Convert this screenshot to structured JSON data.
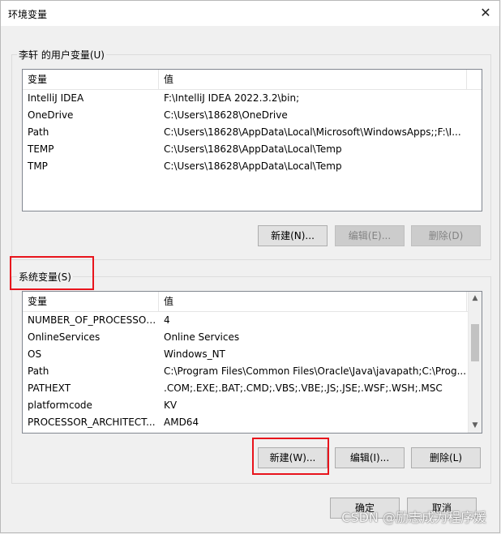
{
  "window": {
    "title": "环境变量",
    "close_glyph": "✕"
  },
  "user_vars": {
    "group_label": "李轩 的用户变量(U)",
    "columns": [
      "变量",
      "值"
    ],
    "rows": [
      [
        "IntelliJ IDEA",
        "F:\\IntelliJ IDEA 2022.3.2\\bin;"
      ],
      [
        "OneDrive",
        "C:\\Users\\18628\\OneDrive"
      ],
      [
        "Path",
        "C:\\Users\\18628\\AppData\\Local\\Microsoft\\WindowsApps;;F:\\I..."
      ],
      [
        "TEMP",
        "C:\\Users\\18628\\AppData\\Local\\Temp"
      ],
      [
        "TMP",
        "C:\\Users\\18628\\AppData\\Local\\Temp"
      ]
    ],
    "buttons": {
      "new": "新建(N)...",
      "edit": "编辑(E)...",
      "delete": "删除(D)"
    }
  },
  "system_vars": {
    "group_label": "系统变量(S)",
    "columns": [
      "变量",
      "值"
    ],
    "rows": [
      [
        "NUMBER_OF_PROCESSORS",
        "4"
      ],
      [
        "OnlineServices",
        "Online Services"
      ],
      [
        "OS",
        "Windows_NT"
      ],
      [
        "Path",
        "C:\\Program Files\\Common Files\\Oracle\\Java\\javapath;C:\\Prog..."
      ],
      [
        "PATHEXT",
        ".COM;.EXE;.BAT;.CMD;.VBS;.VBE;.JS;.JSE;.WSF;.WSH;.MSC"
      ],
      [
        "platformcode",
        "KV"
      ],
      [
        "PROCESSOR_ARCHITECT...",
        "AMD64"
      ]
    ],
    "buttons": {
      "new": "新建(W)...",
      "edit": "编辑(I)...",
      "delete": "删除(L)"
    }
  },
  "footer": {
    "ok": "确定",
    "cancel": "取消"
  },
  "watermark": "CSDN @励志成为程序媛",
  "colors": {
    "highlight": "#e8141c",
    "disabled_text": "#838383"
  }
}
